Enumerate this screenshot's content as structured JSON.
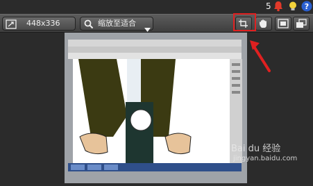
{
  "notifications": {
    "count": "5"
  },
  "toolbar": {
    "image_size": "448x336",
    "zoom_mode": "缩放至适合"
  },
  "watermark": {
    "site_line": "Bai du 经验",
    "url_line": "jingyan.baidu.com"
  },
  "colors": {
    "highlight": "#e02020",
    "toolbar_bg": "#4a4a4a",
    "page_bg": "#2b2b2b"
  }
}
